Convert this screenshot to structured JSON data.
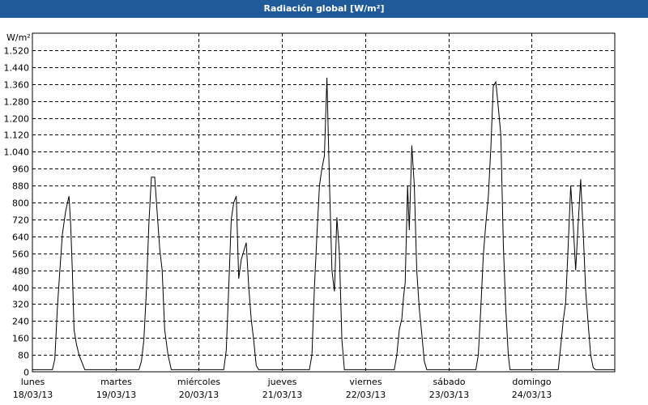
{
  "window": {
    "title": "Radiación global [W/m²]"
  },
  "chart_data": {
    "type": "line",
    "title": "Radiación global [W/m²]",
    "ylabel": "W/m²",
    "ylim": [
      0,
      1600
    ],
    "yticks": [
      "0",
      "80",
      "160",
      "240",
      "320",
      "400",
      "480",
      "560",
      "640",
      "720",
      "800",
      "880",
      "960",
      "1.040",
      "1.120",
      "1.200",
      "1.280",
      "1.360",
      "1.440",
      "1.520"
    ],
    "ytick_values": [
      0,
      80,
      160,
      240,
      320,
      400,
      480,
      560,
      640,
      720,
      800,
      880,
      960,
      1040,
      1120,
      1200,
      1280,
      1360,
      1440,
      1520
    ],
    "xlim": [
      0,
      7
    ],
    "xticks": [
      {
        "day": "lunes",
        "date": "18/03/13",
        "value": 0
      },
      {
        "day": "martes",
        "date": "19/03/13",
        "value": 1
      },
      {
        "day": "miércoles",
        "date": "20/03/13",
        "value": 2
      },
      {
        "day": "jueves",
        "date": "21/03/13",
        "value": 3
      },
      {
        "day": "viernes",
        "date": "22/03/13",
        "value": 4
      },
      {
        "day": "sábado",
        "date": "23/03/13",
        "value": 5
      },
      {
        "day": "domingo",
        "date": "24/03/13",
        "value": 6
      }
    ],
    "grid": true,
    "series": [
      {
        "color": "#000000",
        "points": [
          [
            0.0,
            10
          ],
          [
            0.24,
            10
          ],
          [
            0.27,
            60
          ],
          [
            0.3,
            300
          ],
          [
            0.33,
            480
          ],
          [
            0.36,
            650
          ],
          [
            0.4,
            760
          ],
          [
            0.44,
            830
          ],
          [
            0.46,
            700
          ],
          [
            0.48,
            480
          ],
          [
            0.5,
            200
          ],
          [
            0.53,
            130
          ],
          [
            0.56,
            80
          ],
          [
            0.6,
            40
          ],
          [
            0.63,
            10
          ],
          [
            1.28,
            10
          ],
          [
            1.31,
            50
          ],
          [
            1.34,
            150
          ],
          [
            1.37,
            380
          ],
          [
            1.4,
            700
          ],
          [
            1.43,
            920
          ],
          [
            1.47,
            920
          ],
          [
            1.5,
            750
          ],
          [
            1.53,
            580
          ],
          [
            1.56,
            480
          ],
          [
            1.59,
            200
          ],
          [
            1.63,
            80
          ],
          [
            1.67,
            10
          ],
          [
            2.3,
            10
          ],
          [
            2.33,
            100
          ],
          [
            2.36,
            400
          ],
          [
            2.39,
            720
          ],
          [
            2.42,
            800
          ],
          [
            2.45,
            830
          ],
          [
            2.48,
            440
          ],
          [
            2.51,
            530
          ],
          [
            2.54,
            570
          ],
          [
            2.57,
            610
          ],
          [
            2.6,
            400
          ],
          [
            2.63,
            250
          ],
          [
            2.66,
            150
          ],
          [
            2.69,
            30
          ],
          [
            2.72,
            10
          ],
          [
            3.33,
            10
          ],
          [
            3.36,
            80
          ],
          [
            3.39,
            400
          ],
          [
            3.42,
            650
          ],
          [
            3.45,
            880
          ],
          [
            3.48,
            960
          ],
          [
            3.51,
            1020
          ],
          [
            3.54,
            1390
          ],
          [
            3.57,
            900
          ],
          [
            3.6,
            480
          ],
          [
            3.63,
            380
          ],
          [
            3.66,
            730
          ],
          [
            3.69,
            560
          ],
          [
            3.72,
            150
          ],
          [
            3.75,
            10
          ],
          [
            4.35,
            10
          ],
          [
            4.38,
            80
          ],
          [
            4.41,
            200
          ],
          [
            4.44,
            250
          ],
          [
            4.46,
            350
          ],
          [
            4.48,
            420
          ],
          [
            4.51,
            880
          ],
          [
            4.53,
            670
          ],
          [
            4.56,
            1070
          ],
          [
            4.59,
            880
          ],
          [
            4.62,
            480
          ],
          [
            4.65,
            300
          ],
          [
            4.68,
            180
          ],
          [
            4.71,
            50
          ],
          [
            4.74,
            10
          ],
          [
            5.33,
            10
          ],
          [
            5.36,
            80
          ],
          [
            5.39,
            300
          ],
          [
            5.42,
            550
          ],
          [
            5.45,
            700
          ],
          [
            5.48,
            830
          ],
          [
            5.51,
            1060
          ],
          [
            5.54,
            1350
          ],
          [
            5.57,
            1370
          ],
          [
            5.6,
            1250
          ],
          [
            5.63,
            1120
          ],
          [
            5.66,
            600
          ],
          [
            5.69,
            300
          ],
          [
            5.72,
            80
          ],
          [
            5.74,
            10
          ],
          [
            6.32,
            10
          ],
          [
            6.35,
            120
          ],
          [
            6.38,
            240
          ],
          [
            6.41,
            330
          ],
          [
            6.44,
            600
          ],
          [
            6.47,
            880
          ],
          [
            6.5,
            700
          ],
          [
            6.53,
            480
          ],
          [
            6.56,
            700
          ],
          [
            6.59,
            910
          ],
          [
            6.62,
            660
          ],
          [
            6.65,
            380
          ],
          [
            6.68,
            230
          ],
          [
            6.71,
            80
          ],
          [
            6.74,
            20
          ],
          [
            6.77,
            10
          ],
          [
            7.0,
            10
          ]
        ]
      }
    ]
  }
}
